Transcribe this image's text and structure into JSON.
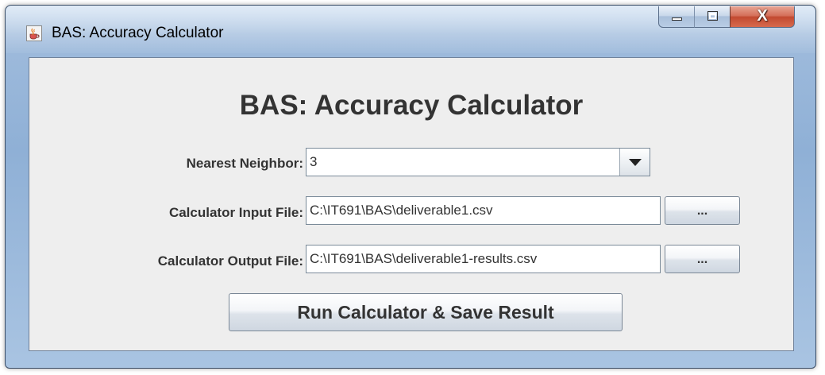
{
  "window": {
    "title": "BAS: Accuracy Calculator",
    "icon": "java-cup-icon",
    "controls": {
      "minimize": "minimize-icon",
      "maximize": "maximize-icon",
      "close_label": "X"
    }
  },
  "form": {
    "heading": "BAS: Accuracy Calculator",
    "nearest_neighbor": {
      "label": "Nearest Neighbor:",
      "value": "3"
    },
    "input_file": {
      "label": "Calculator Input File:",
      "value": "C:\\IT691\\BAS\\deliverable1.csv",
      "browse_label": "..."
    },
    "output_file": {
      "label": "Calculator Output File:",
      "value": "C:\\IT691\\BAS\\deliverable1-results.csv",
      "browse_label": "..."
    },
    "run_button_label": "Run Calculator & Save Result"
  }
}
